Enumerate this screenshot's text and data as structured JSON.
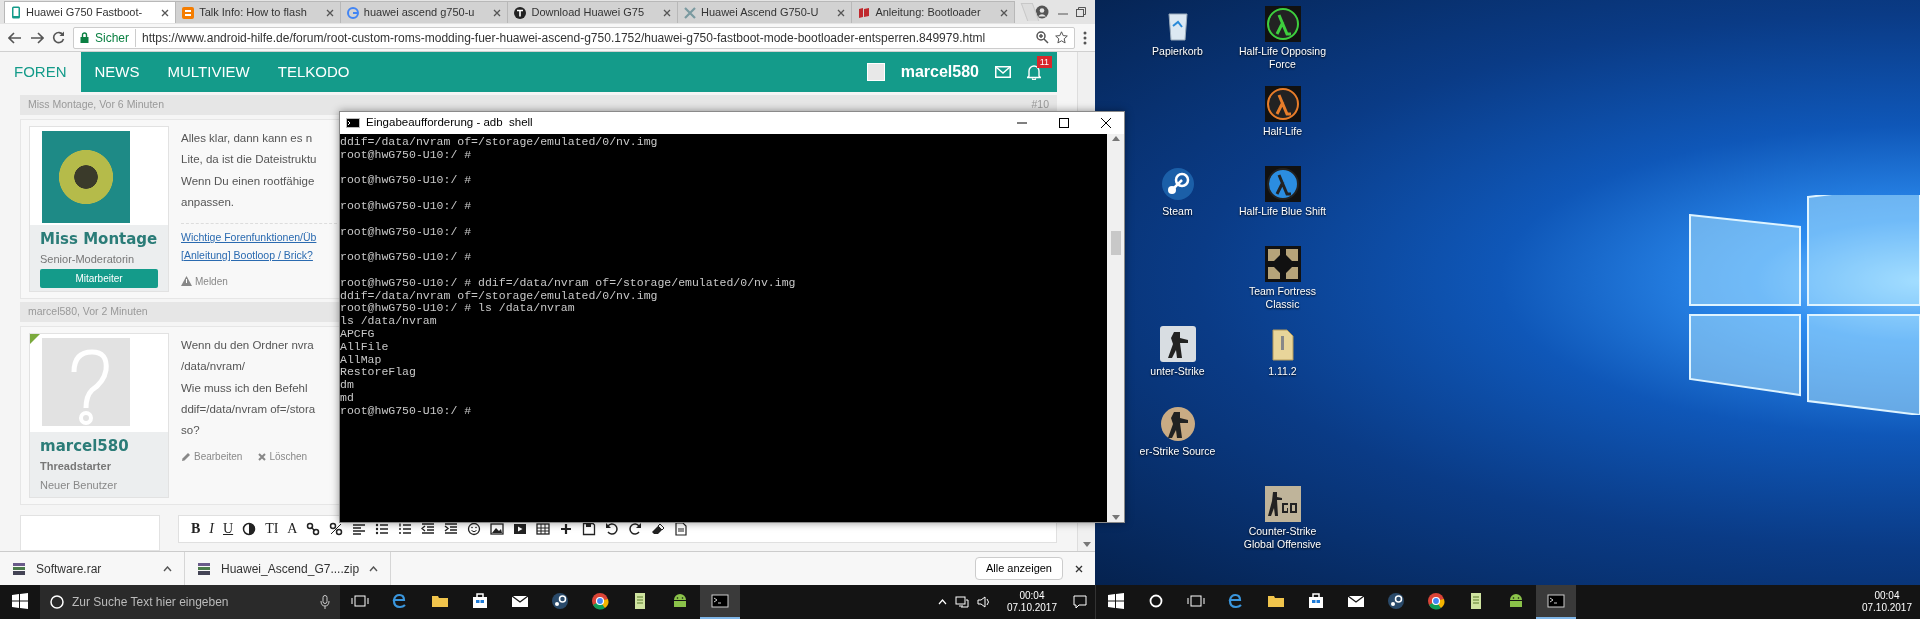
{
  "browser": {
    "tabs": [
      {
        "title": "Huawei G750 Fastboot-",
        "selected": true
      },
      {
        "title": "Talk Info: How to flash",
        "selected": false
      },
      {
        "title": "huawei ascend g750-u",
        "selected": false
      },
      {
        "title": "Download Huawei G75",
        "selected": false
      },
      {
        "title": "Huawei Ascend G750-U",
        "selected": false
      },
      {
        "title": "Anleitung: Bootloader",
        "selected": false
      }
    ],
    "address": {
      "security": "Sicher",
      "url": "https://www.android-hilfe.de/forum/root-custom-roms-modding-fuer-huawei-ascend-g750.1752/huawei-g750-fastboot-mode-bootloader-entsperren.849979.html"
    }
  },
  "forum": {
    "nav": [
      {
        "label": "FOREN",
        "selected": true
      },
      {
        "label": "NEWS",
        "selected": false
      },
      {
        "label": "MULTIVIEW",
        "selected": false
      },
      {
        "label": "TELKODO",
        "selected": false
      }
    ],
    "user": "marcel580",
    "notifications": "11",
    "posts": [
      {
        "header": "Miss Montage, Vor 6 Minuten",
        "number": "#10",
        "avatar": {
          "kind": "photo"
        },
        "starter": false,
        "author": "Miss Montage",
        "title": "Senior-Moderatorin",
        "badge": "Mitarbeiter",
        "body": [
          "Alles klar, dann kann es n",
          "Lite, da ist die Dateistruktu",
          "Wenn Du einen rootfähige",
          "anpassen."
        ],
        "links": [
          "Wichtige Forenfunktionen/Üb",
          "[Anleitung] Bootloop / Brick?"
        ],
        "actions": [
          {
            "kind": "report",
            "label": "Melden"
          }
        ]
      },
      {
        "header": "marcel580, Vor 2 Minuten",
        "avatar": {
          "kind": "generic"
        },
        "starter": true,
        "author": "marcel580",
        "title": "Threadstarter",
        "rank": "Neuer Benutzer",
        "body": [
          "Wenn du den Ordner nvra",
          "/data/nvram/",
          "Wie muss ich den Befehl",
          "ddif=/data/nvram of=/stora",
          "so?"
        ],
        "actions": [
          {
            "kind": "edit",
            "label": "Bearbeiten"
          },
          {
            "kind": "delete",
            "label": "Löschen"
          }
        ]
      }
    ],
    "editor": {
      "toolbar": [
        {
          "kind": "text",
          "label": "B"
        },
        {
          "kind": "text",
          "label": "I"
        },
        {
          "kind": "text",
          "label": "U"
        },
        {
          "kind": "contrast"
        },
        {
          "kind": "text",
          "label": "TI"
        },
        {
          "kind": "text",
          "label": "A"
        },
        {
          "kind": "link"
        },
        {
          "kind": "unlink"
        },
        {
          "kind": "align"
        },
        {
          "kind": "bullets"
        },
        {
          "kind": "numbers"
        },
        {
          "kind": "outdent"
        },
        {
          "kind": "indent"
        },
        {
          "kind": "smiley"
        },
        {
          "kind": "image"
        },
        {
          "kind": "media"
        },
        {
          "kind": "table"
        },
        {
          "kind": "plus"
        },
        {
          "kind": "save"
        },
        {
          "kind": "undo"
        },
        {
          "kind": "redo"
        },
        {
          "kind": "eraser"
        },
        {
          "kind": "source"
        }
      ]
    }
  },
  "downloads": {
    "files": [
      {
        "name": "Software.rar"
      },
      {
        "name": "Huawei_Ascend_G7....zip"
      }
    ],
    "show_all": "Alle anzeigen"
  },
  "terminal": {
    "title": "Eingabeaufforderung - adb  shell",
    "lines": [
      {
        "text": "ddif=/data/nvram of=/storage/emulated/0/nv.img",
        "blank_after": false
      },
      {
        "text": "root@hwG750-U10:/ #",
        "blank_after": true
      },
      {
        "text": "root@hwG750-U10:/ #",
        "blank_after": true
      },
      {
        "text": "root@hwG750-U10:/ #",
        "blank_after": true
      },
      {
        "text": "root@hwG750-U10:/ #",
        "blank_after": true
      },
      {
        "text": "root@hwG750-U10:/ #",
        "blank_after": true
      },
      {
        "text": "root@hwG750-U10:/ # ddif=/data/nvram of=/storage/emulated/0/nv.img",
        "blank_after": false
      },
      {
        "text": "ddif=/data/nvram of=/storage/emulated/0/nv.img",
        "blank_after": false
      },
      {
        "text": "root@hwG750-U10:/ # ls /data/nvram",
        "blank_after": false
      },
      {
        "text": "ls /data/nvram",
        "blank_after": false
      },
      {
        "text": "APCFG",
        "blank_after": false
      },
      {
        "text": "AllFile",
        "blank_after": false
      },
      {
        "text": "AllMap",
        "blank_after": false
      },
      {
        "text": "RestoreFlag",
        "blank_after": false
      },
      {
        "text": "dm",
        "blank_after": false
      },
      {
        "text": "md",
        "blank_after": false
      },
      {
        "text": "root@hwG750-U10:/ #",
        "blank_after": false
      }
    ]
  },
  "desktop": {
    "columns": [
      [
        {
          "label": "Papierkorb",
          "kind": "recycle"
        },
        {
          "label": "Steam",
          "kind": "steam"
        },
        {
          "label": "unter-Strike",
          "kind": "cs"
        },
        {
          "label": "er-Strike Source",
          "kind": "css"
        }
      ],
      [
        {
          "label": "Half-Life Opposing Force",
          "kind": "lambda_green"
        },
        {
          "label": "Half-Life",
          "kind": "lambda_orange"
        },
        {
          "label": "Half-Life Blue Shift",
          "kind": "lambda_blue"
        },
        {
          "label": "Team Fortress Classic",
          "kind": "tfc"
        },
        {
          "label": "1.11.2",
          "kind": "folder"
        },
        {
          "label": "Counter-Strike Global Offensive",
          "kind": "csgo"
        }
      ]
    ]
  },
  "taskbars": [
    {
      "search": "Zur Suche Text hier eingeben",
      "apps": [
        {
          "kind": "edge",
          "selected": false
        },
        {
          "kind": "explorer",
          "selected": false
        },
        {
          "kind": "store",
          "selected": false
        },
        {
          "kind": "mail",
          "selected": false
        },
        {
          "kind": "steam",
          "selected": false
        },
        {
          "kind": "chrome",
          "selected": false
        },
        {
          "kind": "notes",
          "selected": false
        },
        {
          "kind": "android",
          "selected": false
        },
        {
          "kind": "cmd",
          "selected": true
        }
      ],
      "time": "00:04",
      "date": "07.10.2017"
    },
    {
      "apps": [
        {
          "kind": "edge",
          "selected": false
        },
        {
          "kind": "explorer",
          "selected": false
        },
        {
          "kind": "store",
          "selected": false
        },
        {
          "kind": "mail",
          "selected": false
        },
        {
          "kind": "steam",
          "selected": false
        },
        {
          "kind": "chrome",
          "selected": false
        },
        {
          "kind": "notes",
          "selected": false
        },
        {
          "kind": "android",
          "selected": false
        },
        {
          "kind": "cmd",
          "selected": true
        }
      ],
      "time": "00:04",
      "date": "07.10.2017"
    }
  ]
}
